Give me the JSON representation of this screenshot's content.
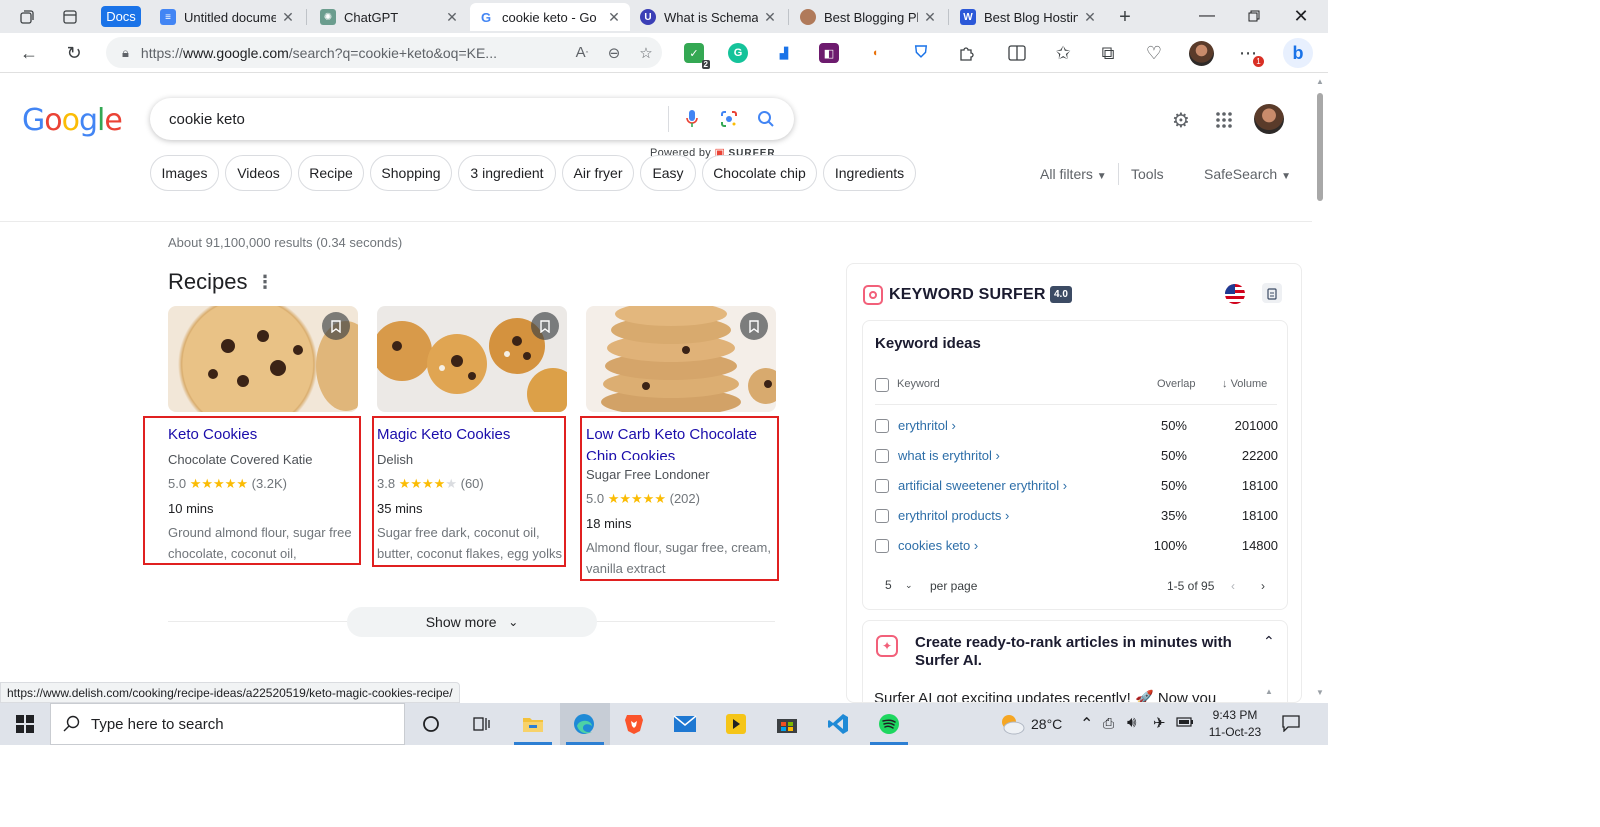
{
  "browser": {
    "tabs": [
      {
        "title": "Untitled docume",
        "active": false
      },
      {
        "title": "ChatGPT",
        "active": false
      },
      {
        "title": "cookie keto - Go",
        "active": true
      },
      {
        "title": "What is Schema",
        "active": false
      },
      {
        "title": "Best Blogging Pl",
        "active": false
      },
      {
        "title": "Best Blog Hostin",
        "active": false
      }
    ],
    "docs_badge": "Docs",
    "url_prefix": "https://",
    "url_host": "www.google.com",
    "url_rest": "/search?q=cookie+keto&oq=KE...",
    "ext_badge_count": "2",
    "menu_badge_count": "1"
  },
  "google": {
    "logo": "Google",
    "query": "cookie keto",
    "powered_by": "Powered by",
    "surfer_brand": "SURFER",
    "chips": [
      "Images",
      "Videos",
      "Recipe",
      "Shopping",
      "3 ingredient",
      "Air fryer",
      "Easy",
      "Chocolate chip",
      "Ingredients"
    ],
    "all_filters": "All filters",
    "tools": "Tools",
    "safesearch": "SafeSearch",
    "stats": "About 91,100,000 results (0.34 seconds)",
    "recipes_heading": "Recipes",
    "show_more": "Show more",
    "status_url": "https://www.delish.com/cooking/recipe-ideas/a22520519/keto-magic-cookies-recipe/"
  },
  "recipes": [
    {
      "title": "Keto Cookies",
      "source": "Chocolate Covered Katie",
      "rating": "5.0",
      "stars_filled": 5,
      "reviews": "(3.2K)",
      "time": "10 mins",
      "ingredients_1": "Ground almond flour, sugar free",
      "ingredients_2": "chocolate, coconut oil,"
    },
    {
      "title": "Magic Keto Cookies",
      "source": "Delish",
      "rating": "3.8",
      "stars_filled": 4,
      "reviews": "(60)",
      "time": "35 mins",
      "ingredients_1": "Sugar free dark, coconut oil,",
      "ingredients_2": "butter, coconut flakes, egg yolks"
    },
    {
      "title_1": "Low Carb Keto Chocolate",
      "title_2": "Chip Cookies",
      "source": "Sugar Free Londoner",
      "rating": "5.0",
      "stars_filled": 5,
      "reviews": "(202)",
      "time": "18 mins",
      "ingredients_1": "Almond flour, sugar free, cream,",
      "ingredients_2": "vanilla extract"
    }
  ],
  "surfer": {
    "title": "KEYWORD SURFER",
    "version": "4.0",
    "ideas_heading": "Keyword ideas",
    "col_keyword": "Keyword",
    "col_overlap": "Overlap",
    "col_volume": "Volume",
    "rows": [
      {
        "keyword": "erythritol",
        "overlap": "50%",
        "volume": "201000"
      },
      {
        "keyword": "what is erythritol",
        "overlap": "50%",
        "volume": "22200"
      },
      {
        "keyword": "artificial sweetener erythritol",
        "overlap": "50%",
        "volume": "18100"
      },
      {
        "keyword": "erythritol products",
        "overlap": "35%",
        "volume": "18100"
      },
      {
        "keyword": "cookies keto",
        "overlap": "100%",
        "volume": "14800"
      }
    ],
    "per_page_value": "5",
    "per_page_label": "per page",
    "range": "1-5 of 95",
    "ai_heading": "Create ready-to-rank articles in minutes with Surfer AI.",
    "ai_text": "Surfer AI got exciting updates recently! 🚀 Now you"
  },
  "taskbar": {
    "search_placeholder": "Type here to search",
    "temperature": "28°C",
    "time": "9:43 PM",
    "date": "11-Oct-23"
  }
}
